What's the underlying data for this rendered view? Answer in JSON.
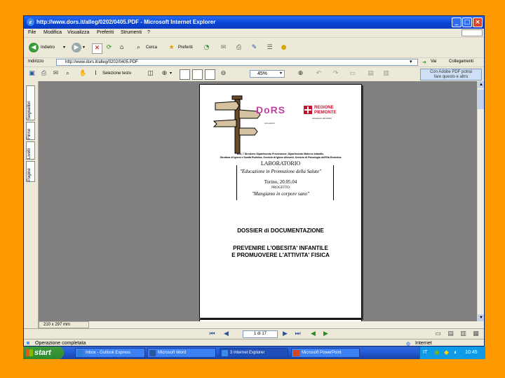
{
  "window": {
    "title": "http://www.dors.it/alleg/0202/0405.PDF - Microsoft Internet Explorer",
    "min_label": "_",
    "max_label": "□",
    "close_label": "×"
  },
  "menu": [
    "File",
    "Modifica",
    "Visualizza",
    "Preferiti",
    "Strumenti",
    "?"
  ],
  "toolbar": {
    "back_label": "Indietro",
    "search_label": "Cerca",
    "favorites_label": "Preferiti"
  },
  "address": {
    "label": "Indirizzo",
    "url": "http://www.dors.it/alleg/0202/0405.PDF",
    "go_label": "Vai",
    "links_label": "Collegamenti"
  },
  "pdf_toolbar": {
    "select_text_label": "Selezione testo",
    "zoom_value": "45%",
    "adobe_line1": "Con Adobe PDF potrai",
    "adobe_line2": "fare questo e altro"
  },
  "nav_tabs": [
    "Segnalibri",
    "Firme",
    "Livelli",
    "Pagine"
  ],
  "pdf_status": {
    "page_size": "210 x 297 mm",
    "page_indicator": "1 di 17"
  },
  "status_bar": {
    "text": "Operazione completata",
    "zone": "Internet"
  },
  "document": {
    "dors_logo": "DoRS",
    "dors_caption": "www.dors.it",
    "region_name": "REGIONE",
    "region_name2": "PIEMONTE",
    "region_caption": "Assessorato alla Sanità",
    "header_line1": "ASL 7 Direzione Dipartimento Prevenzione, Dipartimento Materno Infantile,",
    "header_line2": "Struttura di Igiene e Sanità Pubblica, Servizio di Igiene Alimenti, Servizio di Psicologia dell'Età Evolutiva",
    "lab_title": "LABORATORIO",
    "lab_subtitle": "\"Educazione in Promozione della Salute\"",
    "date_line": "Torino, 20.05.04",
    "project_label": "PROGETTO",
    "project_name": "\"Mangiamo in corpore sano\"",
    "dossier_title": "DOSSIER di DOCUMENTAZIONE",
    "main_title_line1": "PREVENIRE L'OBESITA' INFANTILE",
    "main_title_line2": "E PROMUOVERE L'ATTIVITA' FISICA"
  },
  "taskbar": {
    "start_label": "start",
    "tasks": [
      {
        "label": "Inbox - Outlook Express",
        "active": false,
        "color": "#2f7bd8"
      },
      {
        "label": "Microsoft Word",
        "active": false,
        "color": "#2b579a"
      },
      {
        "label": "3 Internet Explorer",
        "active": true,
        "color": "#3d8ae8"
      },
      {
        "label": "Microsoft PowerPoint",
        "active": false,
        "color": "#d24726"
      }
    ],
    "language": "IT",
    "clock": "10:45"
  },
  "colors": {
    "background": "#ff9900",
    "titlebar": "#0a46d8",
    "chrome": "#ece9d8"
  }
}
